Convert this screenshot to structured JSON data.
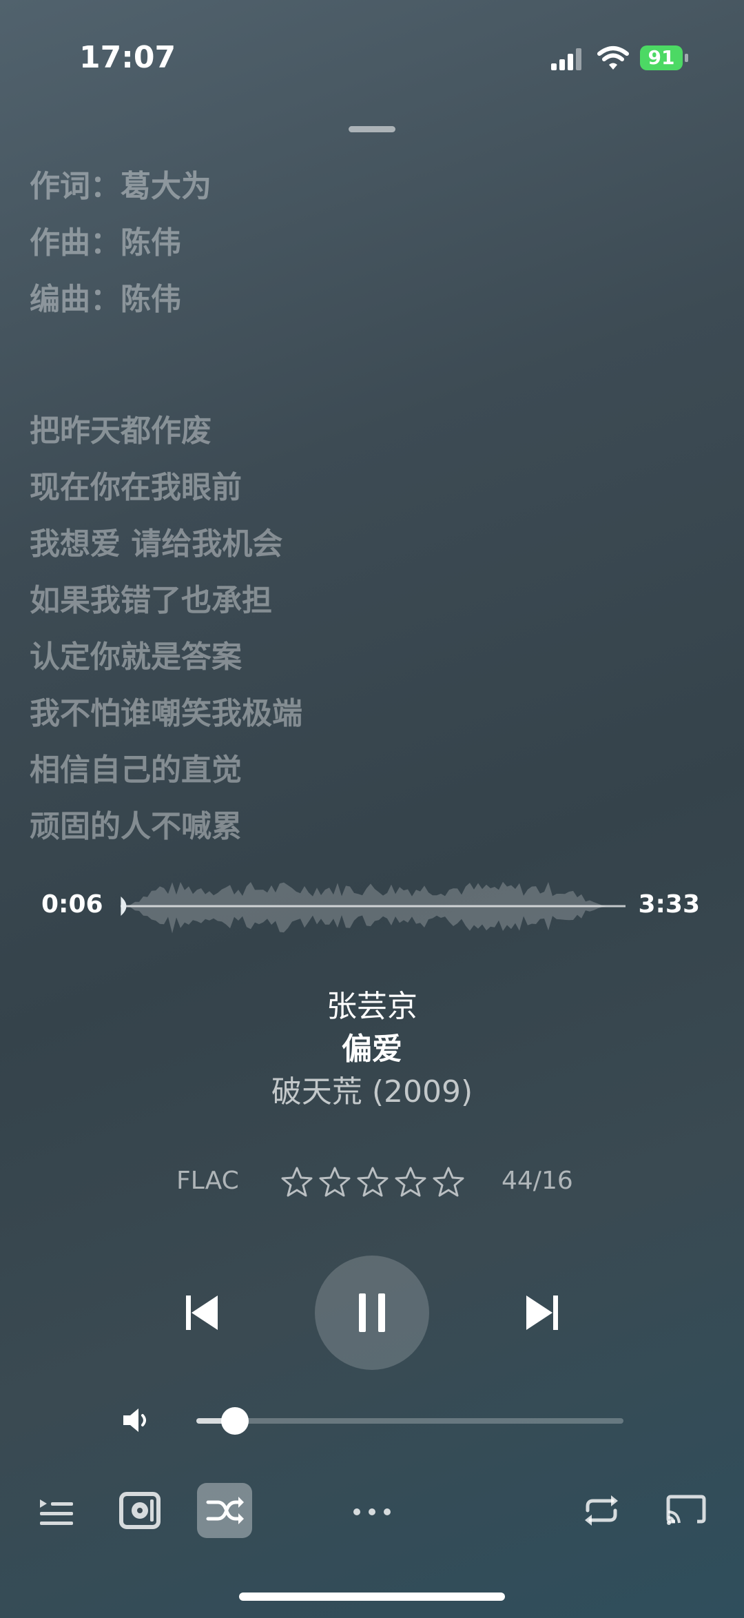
{
  "status_bar": {
    "time": "17:07",
    "battery": "91"
  },
  "lyrics": [
    "作词：葛大为",
    "作曲：陈伟",
    "编曲：陈伟",
    "",
    "把昨天都作废",
    "现在你在我眼前",
    "我想爱 请给我机会",
    "如果我错了也承担",
    "认定你就是答案",
    "我不怕谁嘲笑我极端",
    "相信自己的直觉",
    "顽固的人不喊累"
  ],
  "progress": {
    "elapsed": "0:06",
    "total": "3:33",
    "fraction": 0.028
  },
  "track": {
    "artist": "张芸京",
    "title": "偏爱",
    "album": "破天荒 (2009)"
  },
  "meta": {
    "format": "FLAC",
    "rating": 0,
    "rating_max": 5,
    "count": "44/16"
  },
  "volume": {
    "level": 0.09
  },
  "icons": {
    "prev": "skip-back-icon",
    "pause": "pause-icon",
    "next": "skip-forward-icon",
    "volume": "speaker-icon",
    "queue": "queue-list-icon",
    "source": "device-icon",
    "shuffle": "shuffle-icon",
    "more": "more-icon",
    "repeat": "repeat-icon",
    "cast": "airplay-icon"
  },
  "colors": {
    "battery": "#4cd964"
  }
}
